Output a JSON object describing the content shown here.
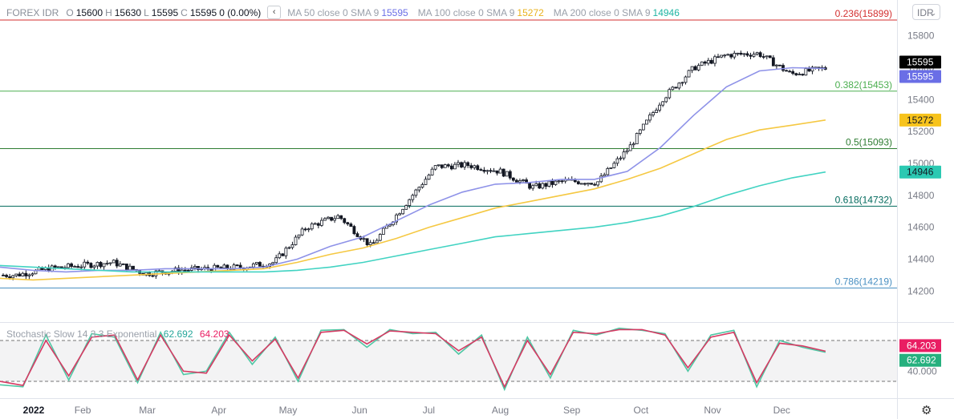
{
  "header": {
    "symbol": "FOREX IDR",
    "o_label": "O",
    "o_value": "15600",
    "h_label": "H",
    "h_value": "15630",
    "l_label": "L",
    "l_value": "15595",
    "c_label": "C",
    "c_value": "15595",
    "change": "0 (0.00%)",
    "toggle_icon": "chevron-left-icon",
    "toggle_glyph": "‹",
    "ma50_label": "MA 50 close 0 SMA 9",
    "ma50_value": "15595",
    "ma100_label": "MA 100 close 0 SMA 9",
    "ma100_value": "15272",
    "ma200_label": "MA 200 close 0 SMA 9",
    "ma200_value": "14946"
  },
  "currency_button": {
    "label": "IDR",
    "icon": "chevron-down-icon",
    "glyph": "⌄"
  },
  "stochastic": {
    "label": "Stochastic Slow 14 3 3 Exponential",
    "k_value": "62.692",
    "d_value": "64.203"
  },
  "settings": {
    "icon": "gear-icon",
    "glyph": "⚙"
  },
  "colors": {
    "up": "#26a69a",
    "down": "#131722",
    "ma50": "#8e92e8",
    "ma100": "#f5c842",
    "ma200": "#41d3c2",
    "stoch_k": "#4fc7a4",
    "stoch_d": "#d63a63",
    "price_badge": "#000000",
    "ma50_badge": "#6a6ee6",
    "ma100_badge": "#f7c31c",
    "ma200_badge": "#2bc9b2",
    "k_badge": "#26b07e",
    "d_badge": "#e91e63"
  },
  "chart_data": [
    {
      "type": "candlestick",
      "title": "FOREX IDR",
      "x_axis": {
        "tick_labels": [
          "2022",
          "Feb",
          "Mar",
          "Apr",
          "May",
          "Jun",
          "Jul",
          "Aug",
          "Sep",
          "Oct",
          "Nov",
          "Dec"
        ]
      },
      "y_axis": {
        "side": "right",
        "range": [
          14100,
          15950
        ],
        "tick_labels": [
          "14200",
          "14400",
          "14600",
          "14800",
          "15000",
          "15200",
          "15400",
          "15600",
          "15800"
        ]
      },
      "grid": false,
      "price_close_series": {
        "x": [
          "2022-01-03",
          "2022-01-17",
          "2022-01-31",
          "2022-02-14",
          "2022-02-28",
          "2022-03-14",
          "2022-03-28",
          "2022-04-11",
          "2022-04-25",
          "2022-05-09",
          "2022-05-23",
          "2022-06-06",
          "2022-06-20",
          "2022-07-04",
          "2022-07-18",
          "2022-08-01",
          "2022-08-15",
          "2022-08-29",
          "2022-09-12",
          "2022-09-26",
          "2022-10-10",
          "2022-10-24",
          "2022-11-07",
          "2022-11-21",
          "2022-12-05",
          "2022-12-19"
        ],
        "close": [
          14300,
          14340,
          14360,
          14380,
          14310,
          14330,
          14340,
          14350,
          14380,
          14600,
          14670,
          14480,
          14730,
          14980,
          14990,
          14950,
          14850,
          14890,
          14880,
          15100,
          15400,
          15600,
          15680,
          15690,
          15560,
          15595
        ]
      },
      "moving_averages": [
        {
          "name": "MA 50 close 0 SMA 9",
          "last_value": 15595,
          "path": [
            14350,
            14330,
            14320,
            14330,
            14330,
            14340,
            14340,
            14340,
            14350,
            14400,
            14480,
            14540,
            14640,
            14740,
            14820,
            14870,
            14880,
            14900,
            14900,
            14950,
            15100,
            15300,
            15480,
            15580,
            15600,
            15595
          ]
        },
        {
          "name": "MA 100 close 0 SMA 9",
          "last_value": 15272,
          "path": [
            14280,
            14270,
            14280,
            14290,
            14300,
            14310,
            14320,
            14330,
            14340,
            14380,
            14430,
            14470,
            14530,
            14600,
            14660,
            14720,
            14760,
            14800,
            14840,
            14900,
            14970,
            15060,
            15150,
            15210,
            15240,
            15272
          ]
        },
        {
          "name": "MA 200 close 0 SMA 9",
          "last_value": 14946,
          "path": [
            14360,
            14350,
            14340,
            14330,
            14320,
            14320,
            14320,
            14320,
            14320,
            14330,
            14350,
            14380,
            14420,
            14460,
            14500,
            14540,
            14560,
            14580,
            14600,
            14630,
            14670,
            14730,
            14800,
            14860,
            14910,
            14946
          ]
        }
      ],
      "fib_levels": [
        {
          "label": "0.236(15899)",
          "value": 15899,
          "color": "#d32f2f"
        },
        {
          "label": "0.382(15453)",
          "value": 15453,
          "color": "#4caf50"
        },
        {
          "label": "0.5(15093)",
          "value": 15093,
          "color": "#2e7d32"
        },
        {
          "label": "0.618(14732)",
          "value": 14732,
          "color": "#00695c"
        },
        {
          "label": "0.786(14219)",
          "value": 14219,
          "color": "#4a90c2"
        }
      ],
      "last_value_badges": [
        "15595",
        "15595",
        "15272",
        "14946"
      ]
    },
    {
      "type": "line",
      "title": "Stochastic Slow 14 3 3 Exponential",
      "y_axis": {
        "range": [
          0,
          100
        ],
        "tick_labels": [
          "40.000"
        ],
        "bands": [
          80,
          20
        ]
      },
      "series": [
        {
          "name": "K",
          "last_value": 62.692,
          "path": [
            15,
            12,
            88,
            22,
            90,
            85,
            18,
            92,
            30,
            35,
            92,
            45,
            85,
            20,
            95,
            96,
            70,
            96,
            90,
            92,
            60,
            88,
            8,
            85,
            25,
            95,
            88,
            98,
            95,
            90,
            35,
            88,
            95,
            12,
            80,
            70,
            62.692
          ]
        },
        {
          "name": "D",
          "last_value": 64.203,
          "path": [
            20,
            14,
            80,
            28,
            85,
            88,
            22,
            88,
            35,
            32,
            88,
            50,
            82,
            25,
            92,
            95,
            75,
            94,
            92,
            90,
            65,
            85,
            12,
            80,
            30,
            92,
            90,
            96,
            96,
            88,
            40,
            85,
            92,
            18,
            76,
            72,
            64.203
          ]
        }
      ]
    }
  ]
}
